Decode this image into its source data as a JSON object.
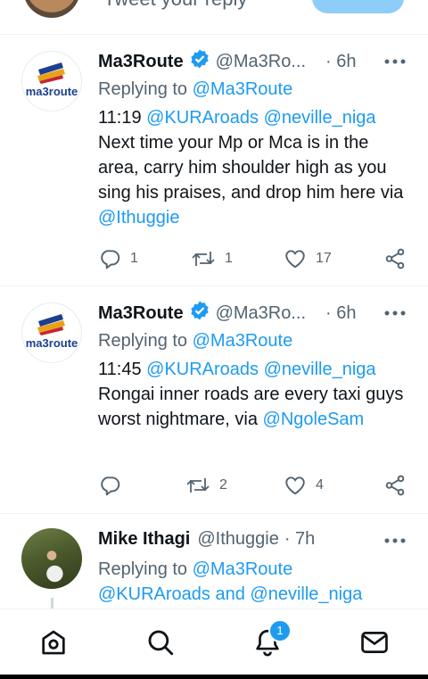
{
  "compose": {
    "placeholder": "Tweet your reply"
  },
  "tweets": [
    {
      "name": "Ma3Route",
      "handle": "@Ma3Ro...",
      "time": "· 6h",
      "replying_label": "Replying to",
      "replying_to": "@Ma3Route",
      "time_stamp": "11:19",
      "mention1": "@KURAroads",
      "mention2": "@neville_niga",
      "body": " Next time your Mp or Mca is in the area, carry him shoulder high as you sing his praises, and drop him here via",
      "via": "@Ithuggie",
      "replies": "1",
      "retweets": "1",
      "likes": "17"
    },
    {
      "name": "Ma3Route",
      "handle": "@Ma3Ro...",
      "time": "· 6h",
      "replying_label": "Replying to",
      "replying_to": "@Ma3Route",
      "time_stamp": "11:45",
      "mention1": "@KURAroads",
      "mention2": "@neville_niga",
      "body": " Rongai inner roads are every taxi guys worst nightmare, via",
      "via": "@NgoleSam",
      "replies": "",
      "retweets": "2",
      "likes": "4"
    },
    {
      "name": "Mike Ithagi",
      "handle": "@Ithuggie",
      "time": "· 7h",
      "replying_label": "Replying to",
      "replying_to": "@Ma3Route",
      "replying_line2_a": "@KURAroads",
      "replying_and": "and",
      "replying_line2_b": "@neville_niga"
    }
  ],
  "nav": {
    "notifications_badge": "1"
  },
  "colors": {
    "accent": "#1d9bf0",
    "muted": "#536471",
    "text": "#0f1419"
  },
  "icons": [
    "home-icon",
    "search-icon",
    "notifications-icon",
    "messages-icon",
    "reply-icon",
    "retweet-icon",
    "like-icon",
    "share-icon",
    "verified-badge-icon",
    "more-icon"
  ]
}
